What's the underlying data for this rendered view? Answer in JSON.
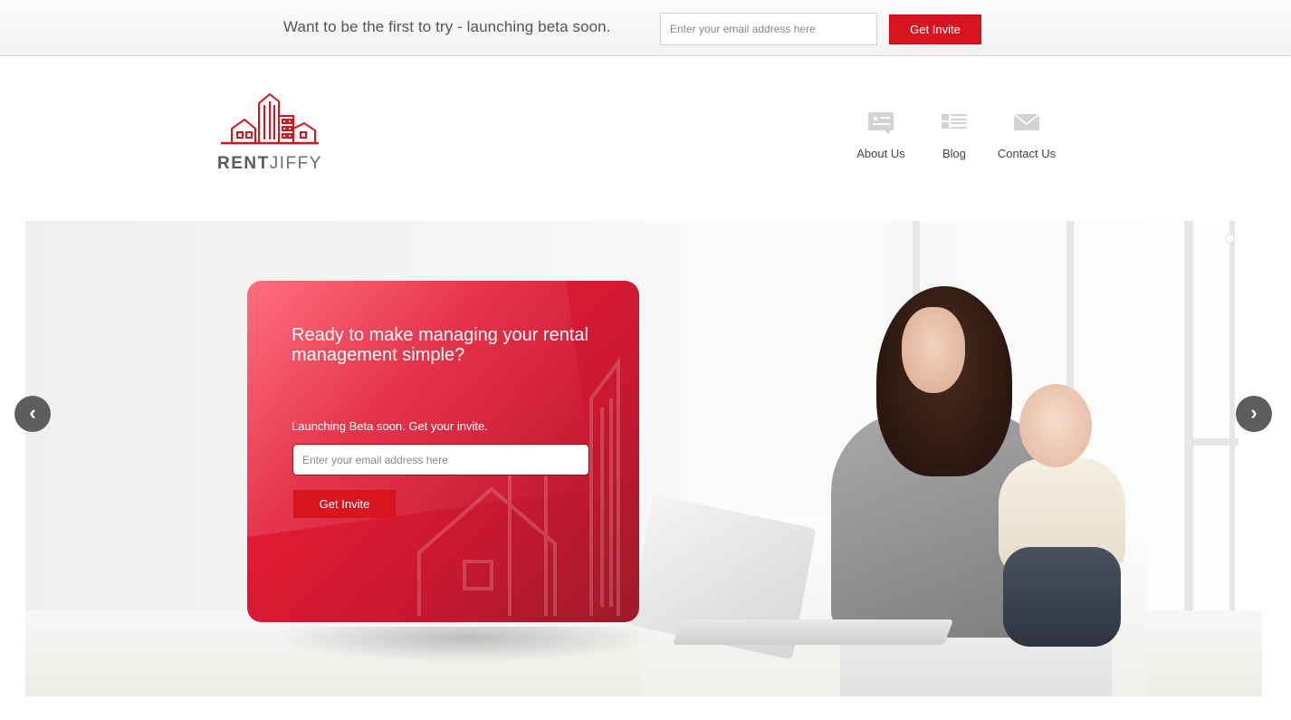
{
  "topbar": {
    "tagline": "Want to be the first to try - launching beta soon.",
    "email_placeholder": "Enter your email address here",
    "invite_label": "Get Invite"
  },
  "logo": {
    "word_bold": "RENT",
    "word_light": "JIFFY"
  },
  "nav": {
    "items": [
      {
        "label": "About Us",
        "icon": "id-card-icon"
      },
      {
        "label": "Blog",
        "icon": "list-icon"
      },
      {
        "label": "Contact Us",
        "icon": "envelope-icon"
      }
    ]
  },
  "hero": {
    "headline": "Ready to make managing your rental management simple?",
    "subtext": "Launching Beta soon. Get your invite.",
    "email_placeholder": "Enter your email address here",
    "invite_label": "Get Invite",
    "prev_arrow": "‹",
    "next_arrow": "›"
  },
  "colors": {
    "brand_red": "#d8141f",
    "card_red": "#e21b34",
    "nav_icon": "#d0d0d0",
    "text_gray": "#444444"
  }
}
